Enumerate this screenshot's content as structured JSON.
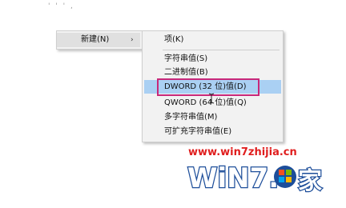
{
  "top_marks": "' ' ' ,",
  "context_menu": {
    "new_item": {
      "label": "新建(N)",
      "arrow": "›"
    }
  },
  "submenu": {
    "items": [
      {
        "label": "项(K)"
      },
      {
        "label": "字符串值(S)"
      },
      {
        "label": "二进制值(B)"
      },
      {
        "label": "DWORD (32 位)值(D)",
        "highlighted": true
      },
      {
        "label": "QWORD (64 位)值(Q)"
      },
      {
        "label": "多字符串值(M)"
      },
      {
        "label": "可扩充字符串值(E)"
      }
    ]
  },
  "watermark": {
    "url": "www.win7zhijia.cn",
    "logo_text": "WiN7.",
    "logo_char": "家"
  },
  "colors": {
    "highlight": "#aad0f3",
    "annotation_box": "#c8287a",
    "watermark_red": "#e01e1e",
    "logo_blue": "#1d4e9a"
  }
}
